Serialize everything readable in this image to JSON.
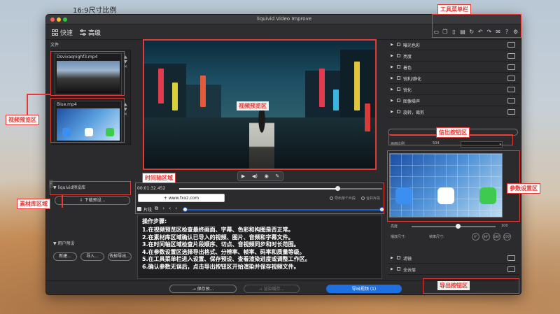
{
  "caption": "16:9尺寸比例",
  "window": {
    "title": "liquivid Video Improve"
  },
  "modes": {
    "quick": "快速",
    "advanced": "高级"
  },
  "toolbar_icons": [
    "folder-icon",
    "copy-icon",
    "paste-icon",
    "clipboard-icon",
    "refresh-icon",
    "undo-icon",
    "redo-icon",
    "mail-icon",
    "help-icon",
    "settings-icon"
  ],
  "files": {
    "label": "文件",
    "items": [
      {
        "name": "Dsvivaqnighf3.mp4"
      },
      {
        "name": "Blue.mp4"
      }
    ]
  },
  "library": {
    "label": "liquivid预设库",
    "download_label": "下载预设..."
  },
  "user_preset": {
    "label": "用户预设",
    "buttons": [
      "新建...",
      "导入...",
      "去掉导出..."
    ]
  },
  "timeline": {
    "timecode": "00:01:32.452",
    "progress": 0.78
  },
  "watermark_button": "+ www.fxxz.com",
  "options": [
    {
      "label": "导出单个片段"
    },
    {
      "label": "合并片段"
    }
  ],
  "clip": {
    "label": "片段",
    "start": 0.0,
    "end": 1.0
  },
  "steps": {
    "title": "操作步骤:",
    "items": [
      "1.在视频预览区检查最终画面、字幕、色彩和构图是否正常。",
      "2.在素材库区域确认已导入的视频、图片、音频和字幕文件。",
      "3.在时间轴区域检查片段顺序、切点、音视频同步和时长范围。",
      "4.在参数设置区选择导出格式、分辨率、帧率、码率和质量等级。",
      "5.在工具菜单栏进入设置、保存预设、查看渲染进度或调整工作区。",
      "6.确认参数无误后，点击导出按钮区开始渲染并保存视频文件。"
    ]
  },
  "effects": {
    "items": [
      {
        "label": "曝光色彩"
      },
      {
        "label": "亮度"
      },
      {
        "label": "着色"
      },
      {
        "label": "锐利/静化"
      },
      {
        "label": "锐化"
      },
      {
        "label": "图像噪声"
      },
      {
        "label": "旋转，裁剪"
      }
    ],
    "add_label": "+ 添加效果..."
  },
  "param": {
    "row_label": "画面比例",
    "row_value": "504",
    "slider_label": "亮度",
    "slider_value_text": "100",
    "slider_value": 0.55,
    "format_label": "播放尺寸:",
    "format_hint": "帧率尺寸:",
    "circle_buttons": [
      "0°",
      "90°",
      "180°",
      "270°"
    ]
  },
  "lower_effects": [
    {
      "label": "滤镜"
    },
    {
      "label": "全云层"
    }
  ],
  "bottom": {
    "save_label": "→ 保存预...",
    "cache_label": "→ 渲染缓存...",
    "export_label": "导出视频 (1)"
  },
  "annotations": {
    "toolbar": "工具菜单栏",
    "preview_left": "视频预览区",
    "preview_center": "视频预览区",
    "timeline": "时间轴区域",
    "library": "素材库区域",
    "signal": "信出按钮区",
    "params": "参数设置区",
    "export": "导出按钮区"
  }
}
